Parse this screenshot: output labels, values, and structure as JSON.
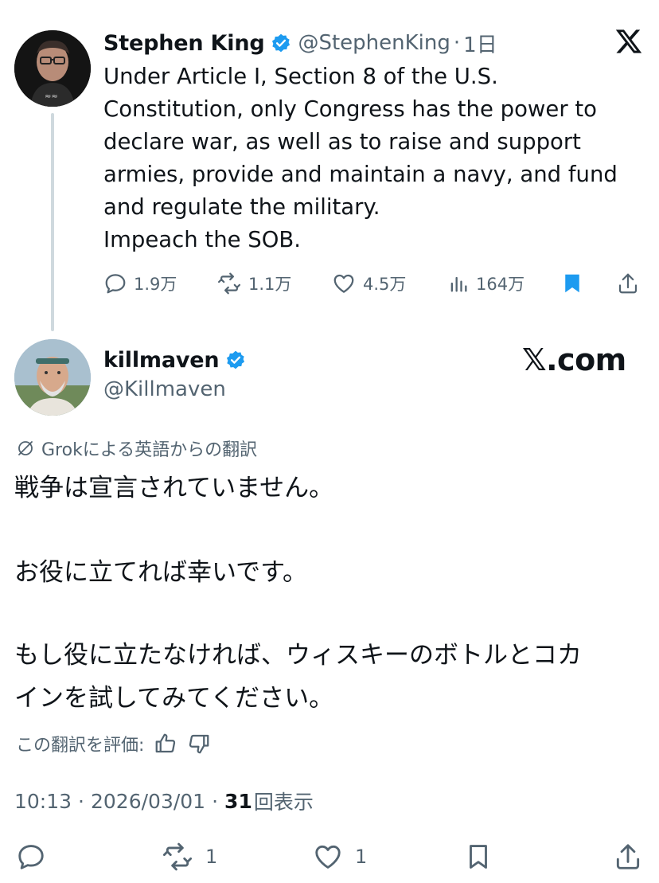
{
  "parent_tweet": {
    "display_name": "Stephen King",
    "handle": "@StephenKing",
    "separator": "·",
    "time": "1日",
    "lines": [
      "Under Article I, Section 8 of the U.S.",
      "Constitution, only Congress has the  power to",
      "declare war, as well as to raise and support",
      "armies, provide  and maintain a navy, and fund",
      "and regulate the military.",
      "Impeach the SOB."
    ],
    "actions": {
      "replies": "1.9万",
      "reposts": "1.1万",
      "likes": "4.5万",
      "views": "164万"
    }
  },
  "reply": {
    "display_name": "killmaven",
    "handle": "@Killmaven",
    "watermark": "𝕏.com",
    "translation_label": "Grokによる英語からの翻訳",
    "paragraphs": [
      "戦争は宣言されていません。",
      "お役に立てれば幸いです。",
      "もし役に立たなければ、ウィスキーのボトルとコカ",
      "インを試してみてください。"
    ],
    "rate_label": "この翻訳を評価:",
    "meta": {
      "time": "10:13",
      "separator": "·",
      "date": "2026/03/01",
      "views_count": "31",
      "views_label": "回表示"
    },
    "actions": {
      "reposts": "1",
      "likes": "1"
    }
  },
  "colors": {
    "verified": "#1d9bf0",
    "bookmark_active": "#1d9bf0",
    "secondary_text": "#536471",
    "thread_line": "#cfd9de"
  }
}
